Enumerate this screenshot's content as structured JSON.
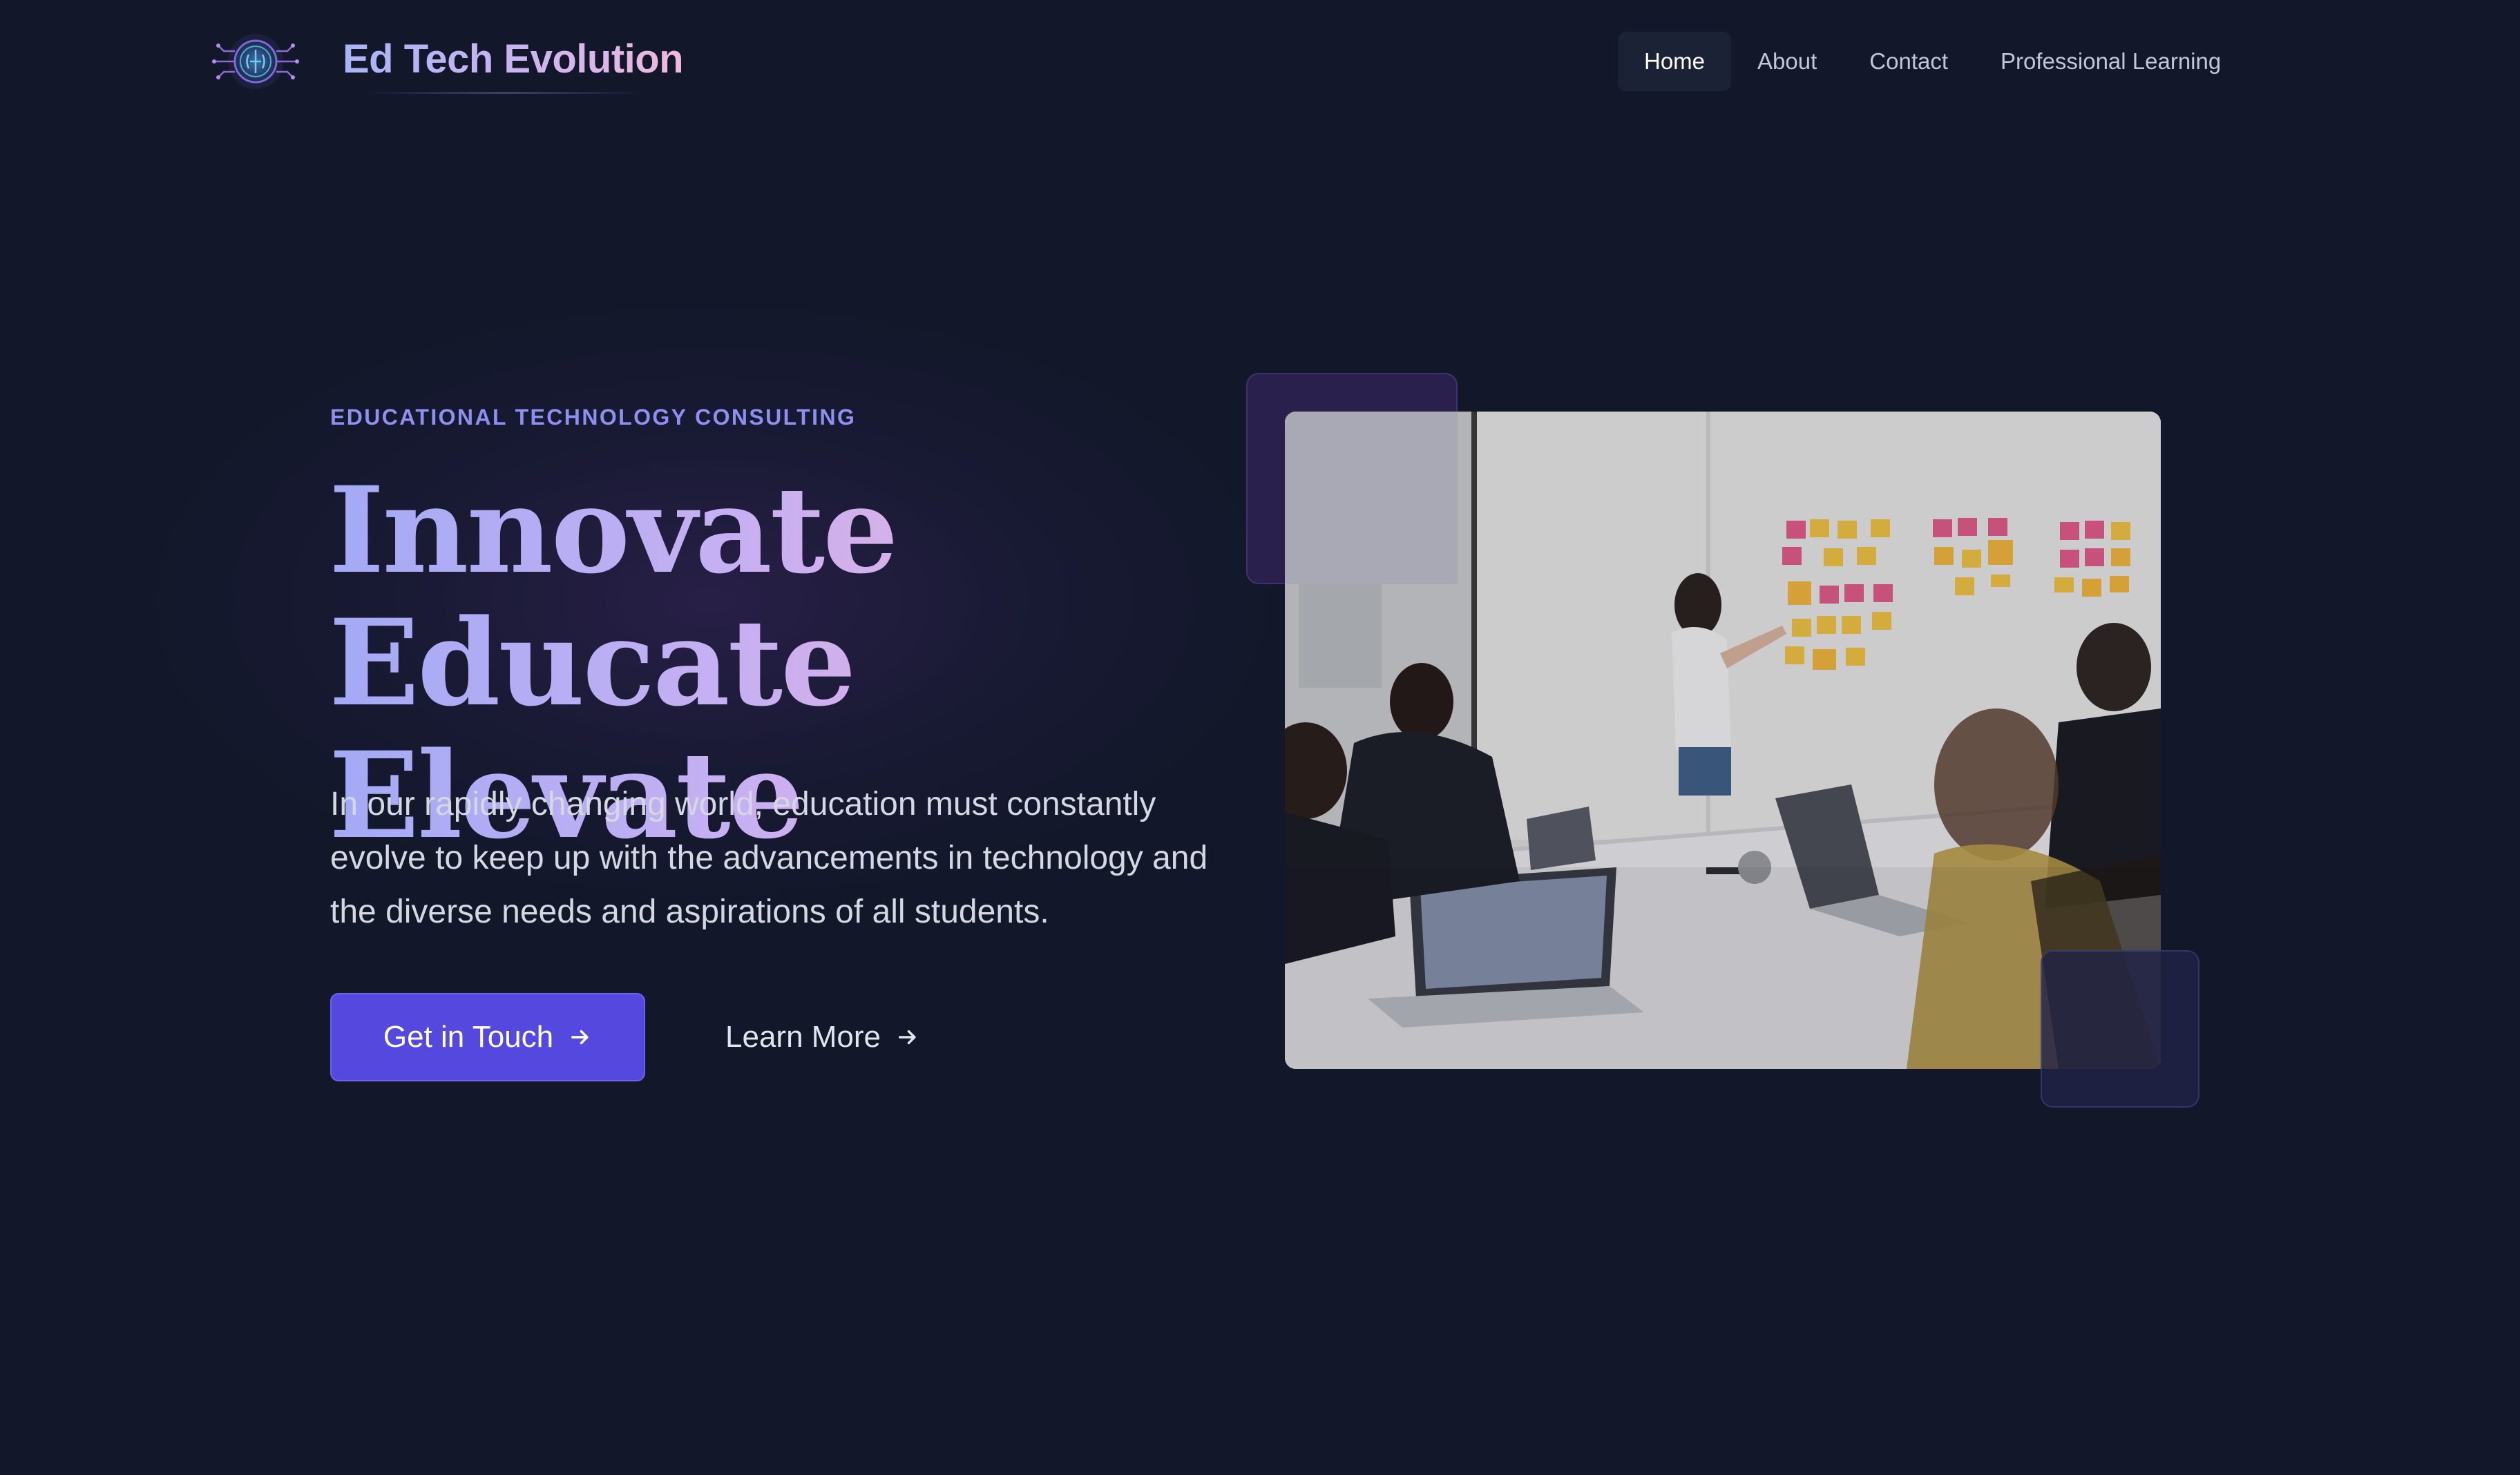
{
  "brand": {
    "name": "Ed Tech Evolution",
    "logo_icon": "circuit-brain-icon"
  },
  "nav": {
    "items": [
      {
        "label": "Home",
        "active": true
      },
      {
        "label": "About",
        "active": false
      },
      {
        "label": "Contact",
        "active": false
      },
      {
        "label": "Professional Learning",
        "active": false
      }
    ]
  },
  "hero": {
    "eyebrow": "EDUCATIONAL TECHNOLOGY CONSULTING",
    "headline_line1": "Innovate",
    "headline_line2": "Educate Elevate",
    "lead": "In our rapidly changing world, education must constantly evolve to keep up with the advancements in technology and the diverse needs and aspirations of all students.",
    "primary_cta": "Get in Touch",
    "secondary_cta": "Learn More",
    "image_icon": "team-meeting-photo"
  },
  "colors": {
    "background": "#121729",
    "accent": "#5548df",
    "eyebrow": "#8e8ff0",
    "gradient_start": "#a3aaf5",
    "gradient_end": "#f2b3d8"
  }
}
